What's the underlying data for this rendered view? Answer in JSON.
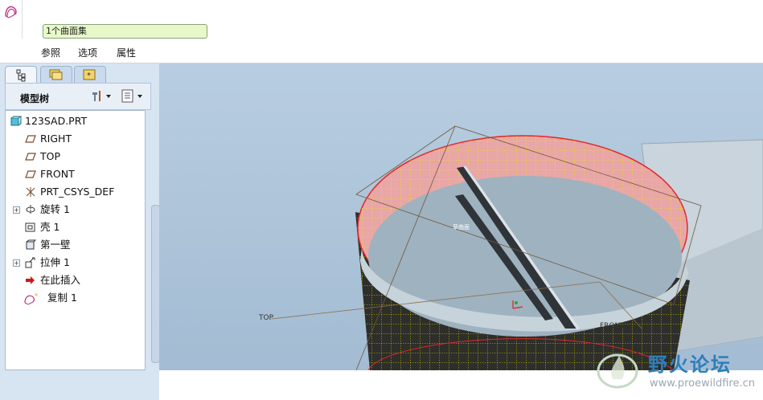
{
  "dashboard": {
    "collector_text": "1个曲面集",
    "tabs": [
      "参照",
      "选项",
      "属性"
    ]
  },
  "navigator": {
    "tabs": [
      "model-tree-tab",
      "folder-browser-tab",
      "favorites-tab"
    ],
    "tree_title": "模型树",
    "nodes": [
      {
        "label": "123SAD.PRT",
        "icon": "part-icon"
      },
      {
        "label": "RIGHT",
        "icon": "datum-plane-icon"
      },
      {
        "label": "TOP",
        "icon": "datum-plane-icon"
      },
      {
        "label": "FRONT",
        "icon": "datum-plane-icon"
      },
      {
        "label": "PRT_CSYS_DEF",
        "icon": "coordinate-system-icon"
      },
      {
        "label": "旋转 1",
        "icon": "revolve-icon"
      },
      {
        "label": "壳 1",
        "icon": "shell-icon"
      },
      {
        "label": "第一壁",
        "icon": "wall-icon"
      },
      {
        "label": "拉伸 1",
        "icon": "extrude-icon"
      },
      {
        "label": "在此插入",
        "icon": "insert-here-arrow-icon"
      },
      {
        "label": "复制 1",
        "icon": "copy-surface-icon"
      }
    ]
  },
  "graphics": {
    "labels": {
      "top_plane": "TOP",
      "front_plane": "FRONT",
      "small_tag": "草曲面"
    }
  },
  "watermark": {
    "title": "野火论坛",
    "url": "www.proewildfire.cn"
  },
  "colors": {
    "background_top": "#b8cde0",
    "surface_highlight": "#e8a6a6",
    "mesh": "#f2f200",
    "edge": "#e3262a",
    "watermark_blue": "#2d7fb9"
  }
}
